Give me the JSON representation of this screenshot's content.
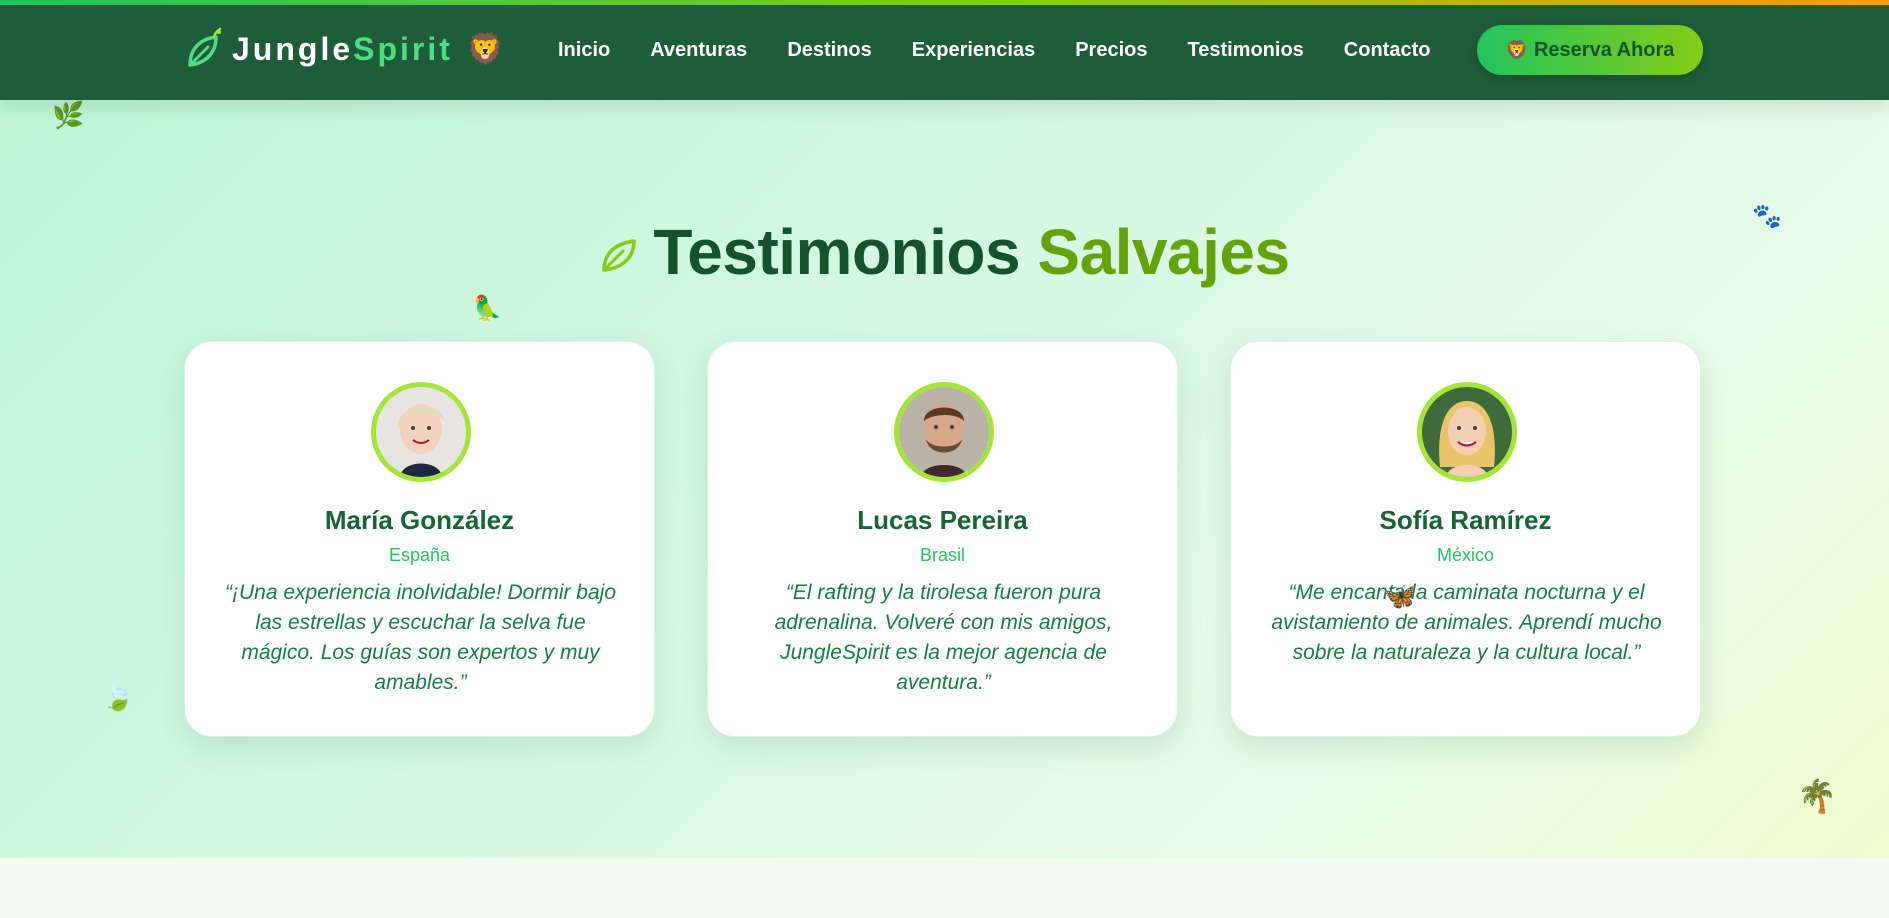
{
  "header": {
    "logo": {
      "text_main": "Jungle",
      "text_accent": "Spirit",
      "leaf_icon": "leaf-icon",
      "lion_icon": "🦁"
    },
    "nav": [
      "Inicio",
      "Aventuras",
      "Destinos",
      "Experiencias",
      "Precios",
      "Testimonios",
      "Contacto"
    ],
    "cta": {
      "icon": "🦁",
      "label": "Reserva Ahora"
    }
  },
  "section": {
    "title_main": "Testimonios",
    "title_accent": "Salvajes"
  },
  "testimonials": [
    {
      "name": "María González",
      "country": "España",
      "quote": "“¡Una experiencia inolvidable! Dormir bajo las estrellas y escuchar la selva fue mágico. Los guías son expertos y muy amables.”"
    },
    {
      "name": "Lucas Pereira",
      "country": "Brasil",
      "quote": "“El rafting y la tirolesa fueron pura adrenalina. Volveré con mis amigos, JungleSpirit es la mejor agencia de aventura.”"
    },
    {
      "name": "Sofía Ramírez",
      "country": "México",
      "quote": "“Me encanta la caminata nocturna y el avistamiento de animales. Aprendí mucho sobre la naturaleza y la cultura local.”"
    }
  ],
  "decorations": {
    "herb": "🌿",
    "paws": "🐾",
    "bird": "🦜",
    "leaves": "🍃",
    "butterfly": "🦋",
    "palm": "🌴"
  },
  "colors": {
    "header_bg": "#1f5c3a",
    "brand_green": "#22c55e",
    "accent_lime": "#84cc16",
    "title_dark": "#14532d",
    "title_accent": "#65a30d"
  }
}
